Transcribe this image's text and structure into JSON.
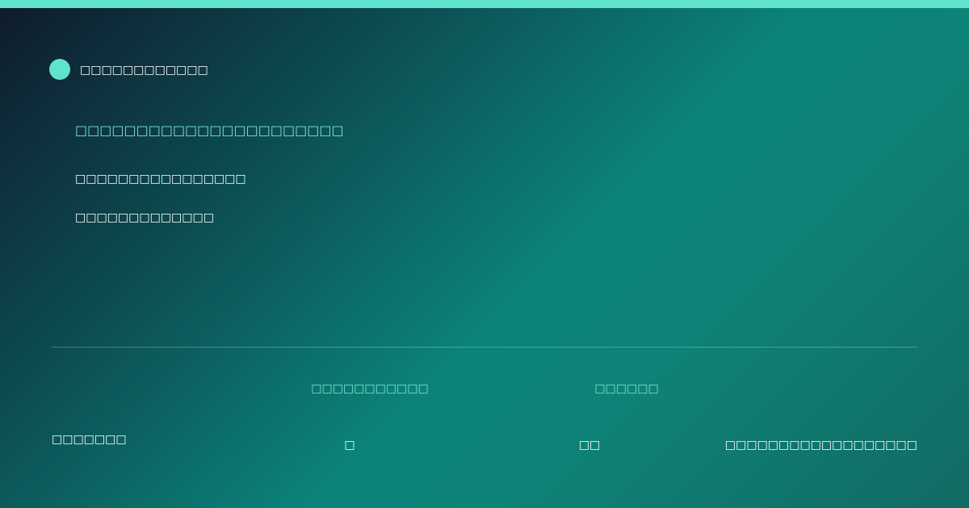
{
  "brand": {
    "name": "□□□□□□□□□□□□",
    "accent_color": "#5fe3cd"
  },
  "hero": {
    "tagline": "□□□□□□□□□□□□□□□□□□□□□□",
    "line_1": "□□□□□□□□□□□□□□□□",
    "line_2": "□□□□□□□□□□□□□"
  },
  "footer": {
    "label": "□□□□□□□",
    "stats": [
      {
        "label": "□□□□□□□□□□□",
        "value": "□"
      },
      {
        "label": "□□□□□□",
        "value": "□□"
      }
    ],
    "right_text": "□□□□□□□□□□□□□□□□□□"
  }
}
